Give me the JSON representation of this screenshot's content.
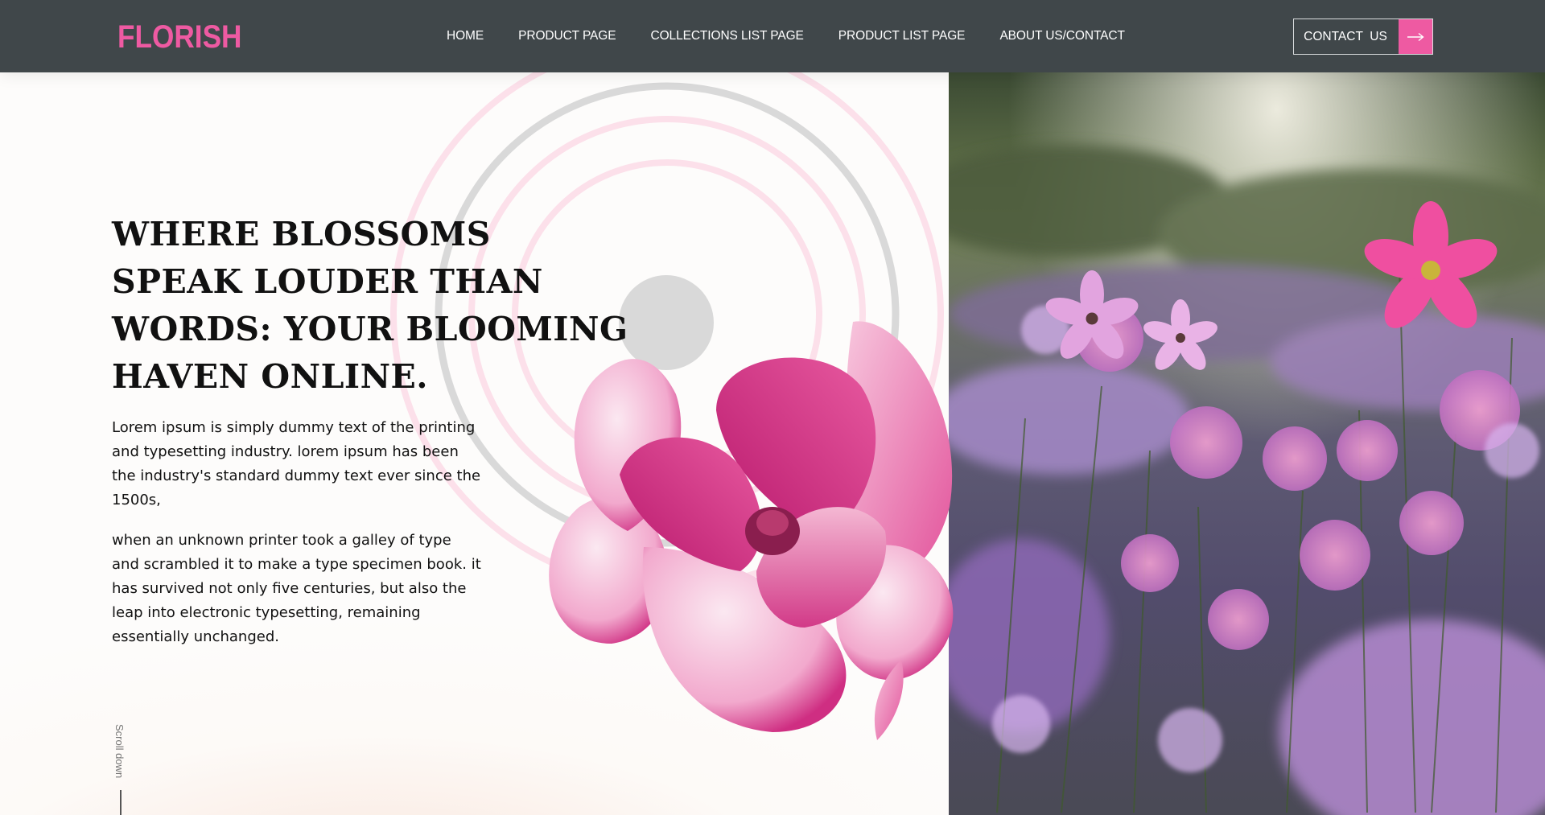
{
  "brand": {
    "logo_text": "FLORISH",
    "accent_color": "#ee5aa2",
    "header_bg": "#40474a"
  },
  "nav": {
    "items": [
      {
        "label": "HOME"
      },
      {
        "label": "PRODUCT PAGE"
      },
      {
        "label": "COLLECTIONS LIST PAGE"
      },
      {
        "label": "PRODUCT LIST PAGE"
      },
      {
        "label": "ABOUT US/CONTACT"
      }
    ],
    "contact_label": "CONTACT  US",
    "contact_icon": "arrow-right-icon"
  },
  "hero": {
    "headline_lines": [
      "WHERE BLOSSOMS",
      "SPEAK LOUDER THAN",
      "WORDS: YOUR BLOOMING",
      "HAVEN ONLINE."
    ],
    "paragraph_1": "Lorem ipsum is simply dummy text of the printing and typesetting industry. lorem ipsum has been the industry's standard dummy text ever since the 1500s,",
    "paragraph_2": "when an unknown printer took a galley of type and scrambled it to make a type specimen book. it has survived not only five centuries, but also the leap into electronic typesetting, remaining essentially unchanged.",
    "scroll_label": "Scroll down",
    "images": [
      "magnolia-flower-image",
      "cosmos-flower-field-image"
    ]
  }
}
